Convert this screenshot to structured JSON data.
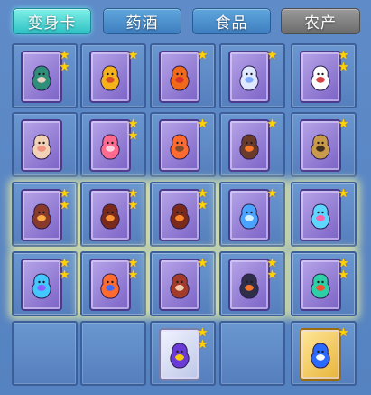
{
  "tabs": [
    {
      "label": "变身卡",
      "state": "active"
    },
    {
      "label": "药酒",
      "state": "normal"
    },
    {
      "label": "食品",
      "state": "normal"
    },
    {
      "label": "农产",
      "state": "disabled"
    }
  ],
  "slots": [
    {
      "card": "purple",
      "stars": 2,
      "figure": "warrior",
      "colors": [
        "#2f8f7a",
        "#f0d6c2"
      ]
    },
    {
      "card": "purple",
      "stars": 1,
      "figure": "lion",
      "colors": [
        "#f5b21a",
        "#d44a2a"
      ]
    },
    {
      "card": "purple",
      "stars": 1,
      "figure": "lion",
      "colors": [
        "#f06a1a",
        "#d62f2f"
      ]
    },
    {
      "card": "purple",
      "stars": 1,
      "figure": "unicorn",
      "colors": [
        "#dfe9ff",
        "#7aa9ff"
      ]
    },
    {
      "card": "purple",
      "stars": 2,
      "figure": "cow",
      "colors": [
        "#ffffff",
        "#d23b3b"
      ]
    },
    {
      "card": "purple",
      "stars": 0,
      "figure": "sheep",
      "colors": [
        "#f2d2b6",
        "#f08f7d"
      ]
    },
    {
      "card": "purple",
      "stars": 2,
      "figure": "girl",
      "colors": [
        "#ff6a8f",
        "#ffd7e3"
      ]
    },
    {
      "card": "purple",
      "stars": 1,
      "figure": "rider",
      "colors": [
        "#ff6b2f",
        "#7b4a2a"
      ]
    },
    {
      "card": "purple",
      "stars": 1,
      "figure": "beast",
      "colors": [
        "#6a3b2a",
        "#ff7a2b"
      ]
    },
    {
      "card": "purple",
      "stars": 1,
      "figure": "knight",
      "colors": [
        "#c99a4a",
        "#3a2a1a"
      ]
    },
    {
      "card": "purple",
      "stars": 2,
      "figure": "rider",
      "colors": [
        "#8a3a2a",
        "#ffb14a"
      ],
      "glow": true
    },
    {
      "card": "purple",
      "stars": 2,
      "figure": "rider",
      "colors": [
        "#7a2a1a",
        "#ff9a3a"
      ],
      "glow": true
    },
    {
      "card": "purple",
      "stars": 2,
      "figure": "rider",
      "colors": [
        "#7a2a1a",
        "#ff8a2a"
      ],
      "glow": true
    },
    {
      "card": "purple",
      "stars": 1,
      "figure": "ice-dragon",
      "colors": [
        "#4aa3ff",
        "#d9f2ff"
      ],
      "glow": true
    },
    {
      "card": "purple",
      "stars": 1,
      "figure": "fairy",
      "colors": [
        "#5fd6ff",
        "#ff5fa9"
      ],
      "glow": true
    },
    {
      "card": "purple",
      "stars": 2,
      "figure": "spirit",
      "colors": [
        "#42c7ff",
        "#8a5cff"
      ],
      "glow": true
    },
    {
      "card": "purple",
      "stars": 2,
      "figure": "fighter",
      "colors": [
        "#ff6a2f",
        "#3a6aff"
      ],
      "glow": true
    },
    {
      "card": "purple",
      "stars": 1,
      "figure": "fighter",
      "colors": [
        "#a33a2a",
        "#f2d2b6"
      ],
      "glow": true
    },
    {
      "card": "purple",
      "stars": 2,
      "figure": "beast",
      "colors": [
        "#2f2f4a",
        "#ff7a2b"
      ],
      "glow": true
    },
    {
      "card": "purple",
      "stars": 2,
      "figure": "dragon",
      "colors": [
        "#2ccfa6",
        "#ff4a2a"
      ],
      "glow": true
    },
    {
      "card": "empty",
      "stars": 0
    },
    {
      "card": "empty",
      "stars": 0
    },
    {
      "card": "silver",
      "stars": 2,
      "figure": "mage",
      "colors": [
        "#6a3bd6",
        "#ffd400"
      ]
    },
    {
      "card": "empty",
      "stars": 0
    },
    {
      "card": "gold",
      "stars": 1,
      "figure": "sage",
      "colors": [
        "#2a6aff",
        "#ffffff"
      ]
    }
  ]
}
